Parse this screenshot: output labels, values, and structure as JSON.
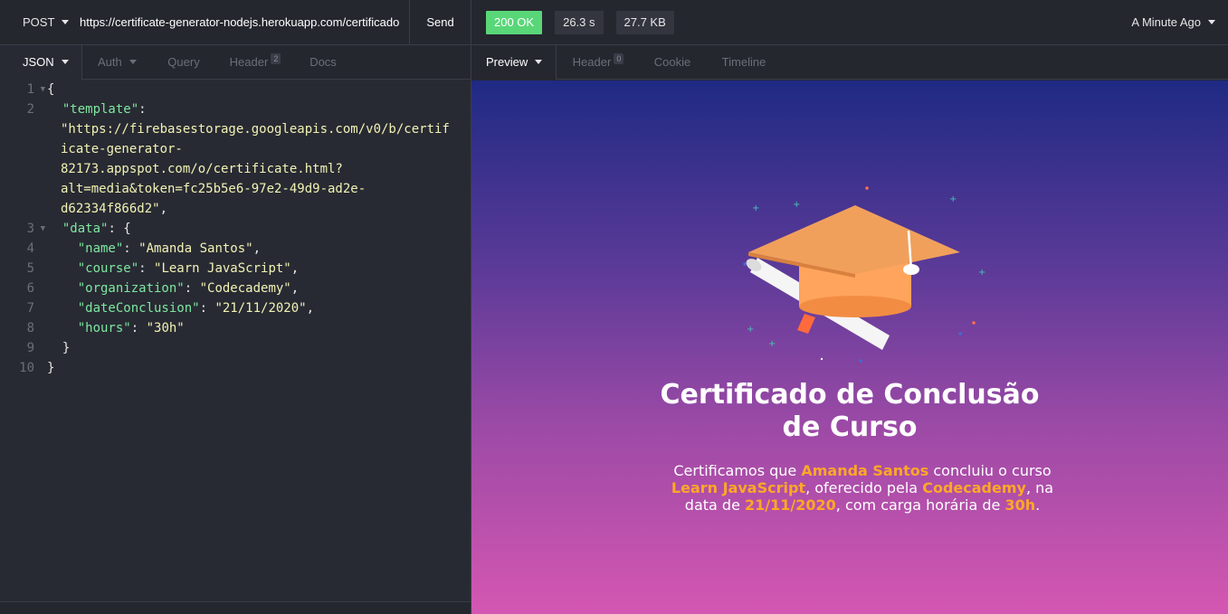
{
  "request": {
    "method": "POST",
    "url": "https://certificate-generator-nodejs.herokuapp.com/certificado",
    "send_label": "Send"
  },
  "request_tabs": {
    "body": "JSON",
    "auth": "Auth",
    "query": "Query",
    "header": "Header",
    "header_count": "2",
    "docs": "Docs"
  },
  "editor": {
    "line_numbers": [
      "1",
      "2",
      "3",
      "4",
      "5",
      "6",
      "7",
      "8",
      "9",
      "10"
    ],
    "template_key": "\"template\"",
    "template_value_lines": [
      "\"https://firebasestorage.googleapis.com/v0/b/certif",
      "icate-generator-",
      "82173.appspot.com/o/certificate.html?",
      "alt=media&token=fc25b5e6-97e2-49d9-ad2e-",
      "d62334f866d2\""
    ],
    "data_key": "\"data\"",
    "name_key": "\"name\"",
    "name_value": "\"Amanda Santos\"",
    "course_key": "\"course\"",
    "course_value": "\"Learn JavaScript\"",
    "organization_key": "\"organization\"",
    "organization_value": "\"Codecademy\"",
    "date_key": "\"dateConclusion\"",
    "date_value": "\"21/11/2020\"",
    "hours_key": "\"hours\"",
    "hours_value": "\"30h\""
  },
  "response": {
    "status": "200 OK",
    "time": "26.3 s",
    "size": "27.7 KB",
    "history": "A Minute Ago"
  },
  "response_tabs": {
    "preview": "Preview",
    "header": "Header",
    "header_count": "0",
    "cookie": "Cookie",
    "timeline": "Timeline"
  },
  "certificate": {
    "title_line1": "Certificado de Conclusão",
    "title_line2": "de Curso",
    "text_1": "Certificamos que ",
    "name": "Amanda Santos",
    "text_2": " concluiu o curso ",
    "course": "Learn JavaScript",
    "text_3": ", oferecido pela ",
    "organization": "Codecademy",
    "text_4": ", na data de ",
    "date": "21/11/2020",
    "text_5": ", com carga horária de ",
    "hours": "30h",
    "text_6": "."
  },
  "colors": {
    "status_ok": "#59d778",
    "json_key": "#7ee7a0",
    "json_string": "#f2f2b4",
    "highlight": "#ffa726",
    "cap": "#f4a05a"
  }
}
